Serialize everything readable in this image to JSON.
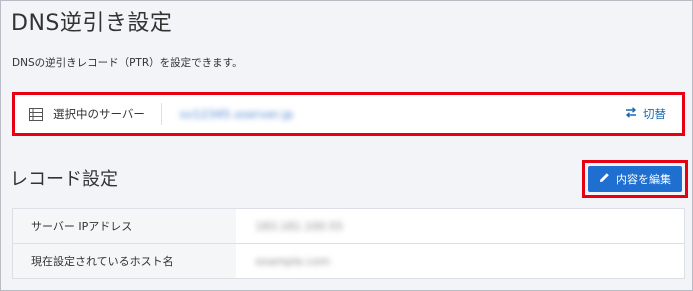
{
  "page": {
    "title": "DNS逆引き設定",
    "description": "DNSの逆引きレコード（PTR）を設定できます。"
  },
  "server": {
    "label": "選択中のサーバー",
    "name": "sv12345.xserver.jp",
    "switch_label": "切替",
    "icon": "server-list-icon",
    "switch_icon": "swap-arrows-icon"
  },
  "record": {
    "section_title": "レコード設定",
    "edit_label": "内容を編集",
    "edit_icon": "pencil-icon",
    "rows": [
      {
        "label": "サーバー IPアドレス",
        "value": "183.181.100.55"
      },
      {
        "label": "現在設定されているホスト名",
        "value": "example.com"
      }
    ]
  },
  "colors": {
    "accent": "#1f6fd1",
    "highlight": "#e60012",
    "link": "#1769b3"
  }
}
